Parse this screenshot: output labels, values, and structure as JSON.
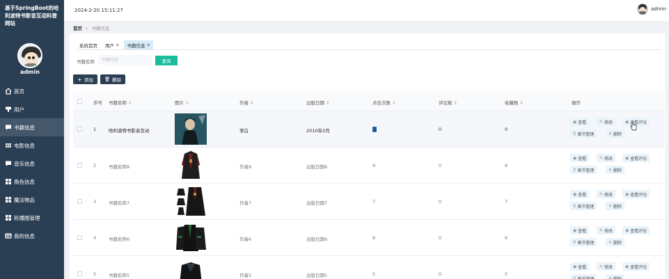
{
  "sidebar": {
    "site_title": "基于SpringBoot的哈利波特书影音互动科普网站",
    "username": "admin",
    "items": [
      {
        "label": "首页",
        "icon": "home-icon"
      },
      {
        "label": "用户",
        "icon": "user-icon"
      },
      {
        "label": "书籍信息",
        "icon": "chat-icon",
        "active": true
      },
      {
        "label": "电影信息",
        "icon": "film-icon"
      },
      {
        "label": "音乐信息",
        "icon": "chat-icon"
      },
      {
        "label": "角色信息",
        "icon": "grid-icon"
      },
      {
        "label": "魔法物品",
        "icon": "grid-icon"
      },
      {
        "label": "轮播图管理",
        "icon": "grid-icon"
      },
      {
        "label": "我的信息",
        "icon": "id-card-icon"
      }
    ]
  },
  "header": {
    "datetime": "2024-2-20 15:11:27",
    "username": "admin"
  },
  "breadcrumb": {
    "home": "首页",
    "separator": "≡",
    "current": "书籍信息"
  },
  "tabs": [
    {
      "label": "系统首页",
      "closable": false
    },
    {
      "label": "用户",
      "closable": true
    },
    {
      "label": "书籍信息",
      "closable": true,
      "active": true
    }
  ],
  "search": {
    "label": "书籍名称",
    "placeholder": "书籍名称",
    "button": "查询"
  },
  "toolbar": {
    "add": "添加",
    "delete": "删除"
  },
  "table": {
    "columns": [
      "序号",
      "书籍名称",
      "图片",
      "作者",
      "出版日期",
      "点击次数",
      "评论数",
      "收藏数",
      "操作"
    ],
    "rows": [
      {
        "index": "1",
        "name": "哈利波特书影音互动",
        "author": "李白",
        "date": "2010年2月",
        "clicks": "9",
        "comments": "0",
        "favorites": "0",
        "image": "poster"
      },
      {
        "index": "2",
        "name": "书籍名称8",
        "author": "作者8",
        "date": "出版日期8",
        "clicks": "9",
        "comments": "0",
        "favorites": "8",
        "image": "robe"
      },
      {
        "index": "3",
        "name": "书籍名称7",
        "author": "作者7",
        "date": "出版日期7",
        "clicks": "7",
        "comments": "0",
        "favorites": "7",
        "image": "set"
      },
      {
        "index": "4",
        "name": "书籍名称6",
        "author": "作者6",
        "date": "出版日期6",
        "clicks": "6",
        "comments": "0",
        "favorites": "6",
        "image": "robes"
      },
      {
        "index": "5",
        "name": "书籍名称5",
        "author": "作者5",
        "date": "出版日期5",
        "clicks": "5",
        "comments": "0",
        "favorites": "5",
        "image": "cloak"
      }
    ],
    "actions": {
      "view": "查看",
      "edit": "修改",
      "view_comments": "查看评论",
      "chapters": "章节管理",
      "delete": "删除"
    }
  },
  "colors": {
    "sidebar": "#2b3f54",
    "accent": "#1abc9c",
    "active_tab": "#d6ecf7",
    "action_bg": "#eaf4fb"
  }
}
